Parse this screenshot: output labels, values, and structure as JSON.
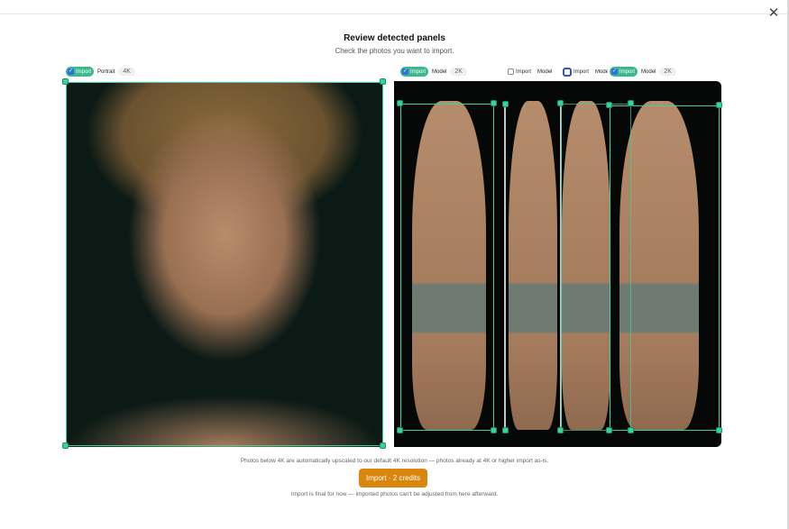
{
  "dialog": {
    "close_glyph": "✕",
    "title": "Review detected panels",
    "subtitle": "Check the photos you want to import."
  },
  "panels": [
    {
      "import_label": "Import",
      "checked": true,
      "tag": "Portrait",
      "resolution": "4K"
    },
    {
      "import_label": "Import",
      "checked": true,
      "tag": "Model",
      "resolution": "2K"
    },
    {
      "import_label": "Import",
      "checked": false,
      "tag": "Model",
      "resolution": ""
    },
    {
      "import_label": "Import",
      "checked": false,
      "tag": "Model",
      "resolution": ""
    },
    {
      "import_label": "Import",
      "checked": true,
      "tag": "Model",
      "resolution": "2K"
    }
  ],
  "check_glyph": "✓",
  "footer": {
    "note": "Photos below 4K are automatically upscaled to our default 4K resolution — photos already at 4K or higher import as-is.",
    "import_button": "Import · 2 credits",
    "footnote": "Import is final for now — imported photos can't be adjusted from here afterward."
  },
  "colors": {
    "accent_green": "#3bb98c",
    "handle_green": "#3bd19a",
    "button_orange": "#d9860f",
    "checkbox_blue": "#2f6fe0"
  },
  "icons": [
    "close-icon",
    "checkmark-icon"
  ]
}
